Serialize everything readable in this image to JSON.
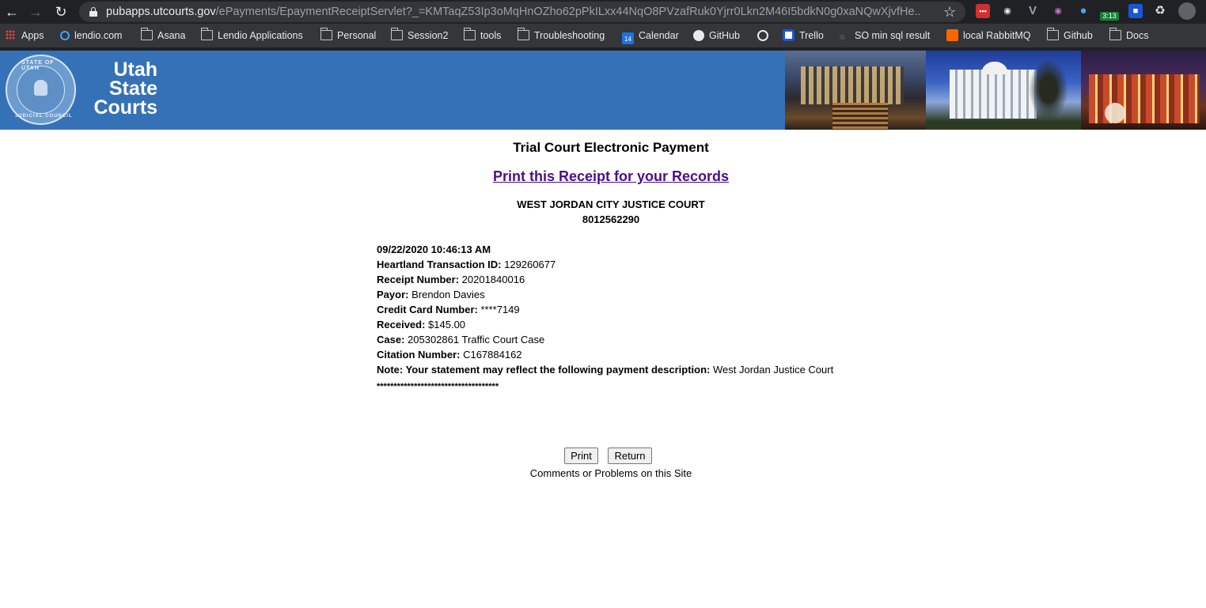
{
  "browser": {
    "url_host": "pubapps.utcourts.gov",
    "url_path": "/ePayments/EpaymentReceiptServlet?_=KMTaqZ53Ip3oMqHnOZho62pPkILxx44NqO8PVzafRuk0Yjrr0Lkn2M46I5bdkN0g0xaNQwXjvfHe...",
    "extension_badge": "3:13",
    "bookmarks": {
      "apps": "Apps",
      "lendio": "lendio.com",
      "asana": "Asana",
      "lendio_apps": "Lendio Applications",
      "personal": "Personal",
      "session2": "Session2",
      "tools": "tools",
      "troubleshooting": "Troubleshooting",
      "calendar": "Calendar",
      "calendar_icon_day": "14",
      "github": "GitHub",
      "trello": "Trello",
      "so_sql": "SO min sql result",
      "rabbitmq": "local RabbitMQ",
      "github_folder": "Github",
      "docs": "Docs"
    }
  },
  "header": {
    "brand_line1": "Utah",
    "brand_line2": "State",
    "brand_line3": "Courts",
    "seal_top": "STATE OF UTAH",
    "seal_bottom": "JUDICIAL COUNCIL",
    "background_color": "#3571b6"
  },
  "receipt": {
    "title": "Trial Court Electronic Payment",
    "print_link": "Print this Receipt for your Records",
    "court_name": "WEST JORDAN CITY JUSTICE COURT",
    "court_phone": "8012562290",
    "datetime": "09/22/2020 10:46:13 AM",
    "fields": [
      {
        "label": "Heartland Transaction ID:",
        "value": "129260677"
      },
      {
        "label": "Receipt Number:",
        "value": "20201840016"
      },
      {
        "label": "Payor:",
        "value": "Brendon Davies"
      },
      {
        "label": "Credit Card Number:",
        "value": "****7149"
      },
      {
        "label": "Received:",
        "value": "$145.00"
      },
      {
        "label": "Case:",
        "value": "205302861 Traffic Court Case"
      },
      {
        "label": "Citation Number:",
        "value": "C167884162"
      },
      {
        "label": "Note: Your statement may reflect the following payment description:",
        "value": "West Jordan Justice Court"
      }
    ],
    "separator": "************************************",
    "print_button": "Print",
    "return_button": "Return",
    "comments": "Comments or Problems on this Site",
    "link_color": "#4b0e8c"
  }
}
